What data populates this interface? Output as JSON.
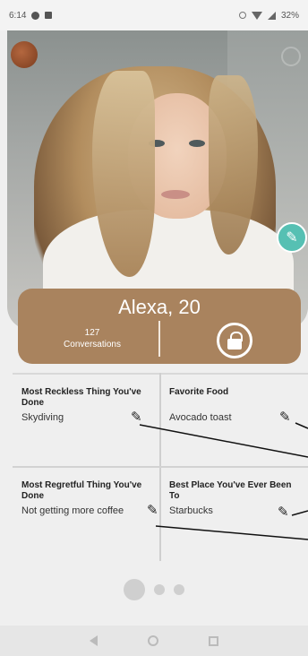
{
  "status_bar": {
    "time": "6:14",
    "battery": "32%"
  },
  "profile": {
    "name_age": "Alexa, 20",
    "conversations_count": "127",
    "conversations_label": "Conversations"
  },
  "qa": [
    {
      "title": "Most Reckless Thing You've Done",
      "answer": "Skydiving"
    },
    {
      "title": "Favorite Food",
      "answer": "Avocado toast"
    },
    {
      "title": "Most Regretful Thing You've Done",
      "answer": "Not getting more coffee"
    },
    {
      "title": "Best Place You've Ever Been To",
      "answer": "Starbucks"
    }
  ],
  "pager": {
    "active_index": 0,
    "count": 3
  },
  "icons": [
    "logo-badge-icon",
    "edit-photo-icon",
    "lock-icon",
    "pencil-icon",
    "back-icon",
    "home-icon",
    "recent-apps-icon"
  ],
  "colors": {
    "card": "#a9835e",
    "edit_button": "#56c0b3"
  }
}
